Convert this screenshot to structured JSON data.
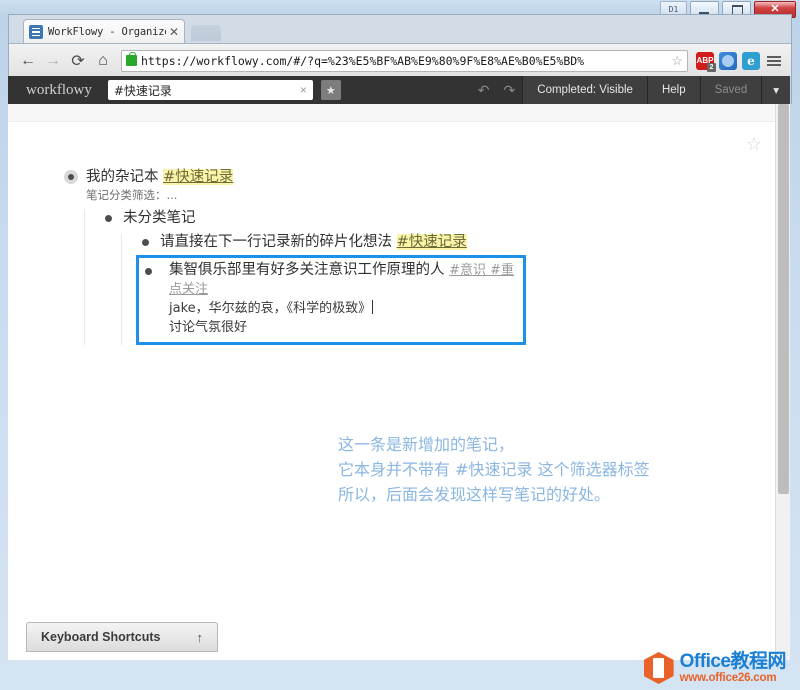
{
  "window": {
    "extra_button_label": "D1",
    "minimize_label": "",
    "maximize_label": "",
    "close_label": "✕"
  },
  "browser": {
    "tab": {
      "title": "WorkFlowy - Organize yo",
      "close_label": "✕",
      "favicon": "workflowy-favicon"
    },
    "nav": {
      "back": "←",
      "forward": "→",
      "reload": "⟳",
      "home": "⌂"
    },
    "omnibox": {
      "scheme": "https://",
      "url_rest": "workflowy.com/#/?q=%23%E5%BF%AB%E9%80%9F%E8%AE%B0%E5%BD%",
      "full_url": "https://workflowy.com/#/?q=%23%E5%BF%AB%E9%80%9F%E8%AE%B0%E5%BD%",
      "bookmark_star": "☆"
    },
    "extensions": [
      {
        "name": "adblock-plus",
        "label": "ABP"
      },
      {
        "name": "blue-circle-extension",
        "label": ""
      },
      {
        "name": "evernote-extension",
        "label": "e"
      },
      {
        "name": "chrome-menu",
        "label": ""
      }
    ]
  },
  "workflowy_bar": {
    "logo": "workflowy",
    "search": {
      "value": "#快速记录",
      "placeholder": "",
      "clear_label": "×"
    },
    "star_button": "★",
    "undo_label": "↶",
    "redo_label": "↷",
    "completed_label": "Completed: Visible",
    "help_label": "Help",
    "saved_label": "Saved",
    "caret_label": "▾"
  },
  "page": {
    "favorite_star": "☆",
    "outline": {
      "root": {
        "text_main": "我的杂记本 ",
        "text_tag": "#快速记录",
        "note": "笔记分类筛选：..."
      },
      "child1": {
        "text": "未分类笔记"
      },
      "child1_item1": {
        "text_main": "请直接在下一行记录新的碎片化想法 ",
        "text_tag": "#快速记录"
      },
      "child1_item2": {
        "text_main": "集智俱乐部里有好多关注意识工作原理的人 ",
        "tag1": "#意识",
        "tag2": "#重点关注",
        "line2": "jake，华尔兹的哀，《科学的极致》",
        "line3": "讨论气氛很好"
      }
    },
    "annotation": {
      "line1": "这一条是新增加的笔记，",
      "line2": "它本身并不带有 #快速记录 这个筛选器标签",
      "line3": "所以，后面会发现这样写笔记的好处。"
    },
    "keyboard_shortcuts": {
      "label": "Keyboard Shortcuts",
      "arrow": "↑"
    }
  },
  "watermark": {
    "title": "Office教程网",
    "subtitle": "www.office26.com"
  },
  "colors": {
    "focus_border": "#1e90e8",
    "annotation": "#8ab6e0",
    "tag_highlight": "#fbf4a8",
    "wf_bar": "#333333",
    "watermark_blue": "#1b7fd4",
    "watermark_orange": "#e8622a"
  }
}
